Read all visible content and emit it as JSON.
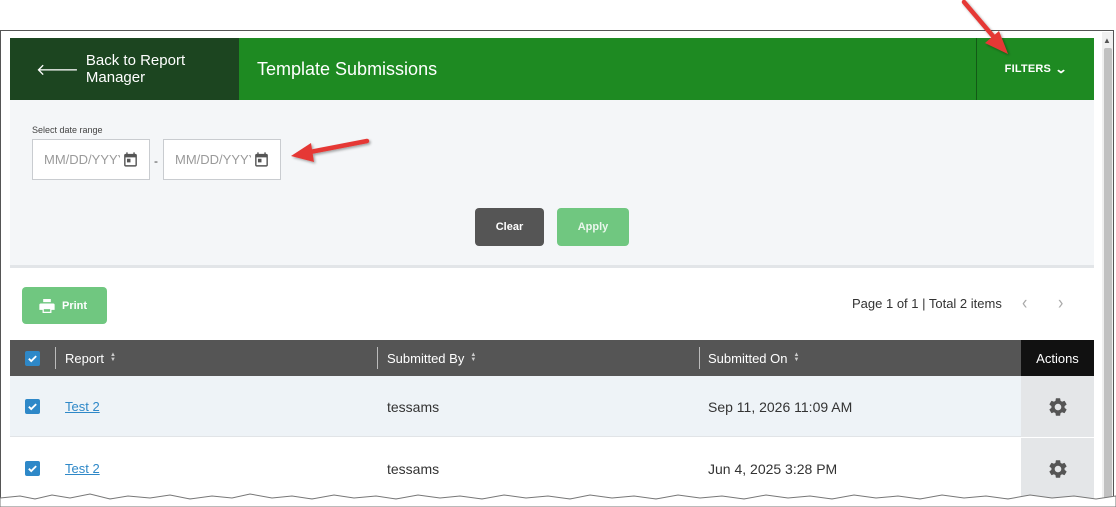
{
  "header": {
    "back_label": "Back to Report Manager",
    "title": "Template Submissions",
    "filters_label": "FILTERS"
  },
  "filters": {
    "range_label": "Select date range",
    "start_placeholder": "MM/DD/YYYY",
    "end_placeholder": "MM/DD/YYYY",
    "separator": "-",
    "clear_label": "Clear",
    "apply_label": "Apply"
  },
  "toolbar": {
    "print_label": "Print",
    "pager_text": "Page 1 of 1 | Total 2 items",
    "prev": "‹",
    "next": "›"
  },
  "table": {
    "columns": [
      "Report",
      "Submitted By",
      "Submitted On",
      "Actions"
    ],
    "rows": [
      {
        "report": "Test 2",
        "submitted_by": "tessams",
        "submitted_on": "Sep 11, 2026 11:09 AM",
        "checked": true
      },
      {
        "report": "Test 2",
        "submitted_by": "tessams",
        "submitted_on": "Jun 4, 2025 3:28 PM",
        "checked": true
      }
    ]
  },
  "colors": {
    "header_green": "#1e8a22",
    "back_dark_green": "#1c4520",
    "apply_green": "#70c780",
    "clear_gray": "#555555",
    "link_blue": "#2e88c8",
    "annotation_red": "#e53935"
  },
  "icons": [
    "back-arrow-icon",
    "chevron-down-icon",
    "calendar-icon",
    "printer-icon",
    "sort-icon",
    "checkbox-checked-icon",
    "gear-icon",
    "chevron-left-icon",
    "chevron-right-icon"
  ]
}
